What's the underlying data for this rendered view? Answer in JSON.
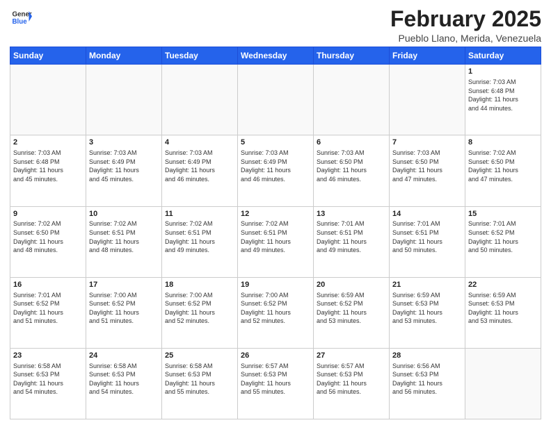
{
  "header": {
    "logo_general": "General",
    "logo_blue": "Blue",
    "month_title": "February 2025",
    "location": "Pueblo Llano, Merida, Venezuela"
  },
  "weekdays": [
    "Sunday",
    "Monday",
    "Tuesday",
    "Wednesday",
    "Thursday",
    "Friday",
    "Saturday"
  ],
  "weeks": [
    [
      {
        "day": "",
        "info": ""
      },
      {
        "day": "",
        "info": ""
      },
      {
        "day": "",
        "info": ""
      },
      {
        "day": "",
        "info": ""
      },
      {
        "day": "",
        "info": ""
      },
      {
        "day": "",
        "info": ""
      },
      {
        "day": "1",
        "info": "Sunrise: 7:03 AM\nSunset: 6:48 PM\nDaylight: 11 hours\nand 44 minutes."
      }
    ],
    [
      {
        "day": "2",
        "info": "Sunrise: 7:03 AM\nSunset: 6:48 PM\nDaylight: 11 hours\nand 45 minutes."
      },
      {
        "day": "3",
        "info": "Sunrise: 7:03 AM\nSunset: 6:49 PM\nDaylight: 11 hours\nand 45 minutes."
      },
      {
        "day": "4",
        "info": "Sunrise: 7:03 AM\nSunset: 6:49 PM\nDaylight: 11 hours\nand 46 minutes."
      },
      {
        "day": "5",
        "info": "Sunrise: 7:03 AM\nSunset: 6:49 PM\nDaylight: 11 hours\nand 46 minutes."
      },
      {
        "day": "6",
        "info": "Sunrise: 7:03 AM\nSunset: 6:50 PM\nDaylight: 11 hours\nand 46 minutes."
      },
      {
        "day": "7",
        "info": "Sunrise: 7:03 AM\nSunset: 6:50 PM\nDaylight: 11 hours\nand 47 minutes."
      },
      {
        "day": "8",
        "info": "Sunrise: 7:02 AM\nSunset: 6:50 PM\nDaylight: 11 hours\nand 47 minutes."
      }
    ],
    [
      {
        "day": "9",
        "info": "Sunrise: 7:02 AM\nSunset: 6:50 PM\nDaylight: 11 hours\nand 48 minutes."
      },
      {
        "day": "10",
        "info": "Sunrise: 7:02 AM\nSunset: 6:51 PM\nDaylight: 11 hours\nand 48 minutes."
      },
      {
        "day": "11",
        "info": "Sunrise: 7:02 AM\nSunset: 6:51 PM\nDaylight: 11 hours\nand 49 minutes."
      },
      {
        "day": "12",
        "info": "Sunrise: 7:02 AM\nSunset: 6:51 PM\nDaylight: 11 hours\nand 49 minutes."
      },
      {
        "day": "13",
        "info": "Sunrise: 7:01 AM\nSunset: 6:51 PM\nDaylight: 11 hours\nand 49 minutes."
      },
      {
        "day": "14",
        "info": "Sunrise: 7:01 AM\nSunset: 6:51 PM\nDaylight: 11 hours\nand 50 minutes."
      },
      {
        "day": "15",
        "info": "Sunrise: 7:01 AM\nSunset: 6:52 PM\nDaylight: 11 hours\nand 50 minutes."
      }
    ],
    [
      {
        "day": "16",
        "info": "Sunrise: 7:01 AM\nSunset: 6:52 PM\nDaylight: 11 hours\nand 51 minutes."
      },
      {
        "day": "17",
        "info": "Sunrise: 7:00 AM\nSunset: 6:52 PM\nDaylight: 11 hours\nand 51 minutes."
      },
      {
        "day": "18",
        "info": "Sunrise: 7:00 AM\nSunset: 6:52 PM\nDaylight: 11 hours\nand 52 minutes."
      },
      {
        "day": "19",
        "info": "Sunrise: 7:00 AM\nSunset: 6:52 PM\nDaylight: 11 hours\nand 52 minutes."
      },
      {
        "day": "20",
        "info": "Sunrise: 6:59 AM\nSunset: 6:52 PM\nDaylight: 11 hours\nand 53 minutes."
      },
      {
        "day": "21",
        "info": "Sunrise: 6:59 AM\nSunset: 6:53 PM\nDaylight: 11 hours\nand 53 minutes."
      },
      {
        "day": "22",
        "info": "Sunrise: 6:59 AM\nSunset: 6:53 PM\nDaylight: 11 hours\nand 53 minutes."
      }
    ],
    [
      {
        "day": "23",
        "info": "Sunrise: 6:58 AM\nSunset: 6:53 PM\nDaylight: 11 hours\nand 54 minutes."
      },
      {
        "day": "24",
        "info": "Sunrise: 6:58 AM\nSunset: 6:53 PM\nDaylight: 11 hours\nand 54 minutes."
      },
      {
        "day": "25",
        "info": "Sunrise: 6:58 AM\nSunset: 6:53 PM\nDaylight: 11 hours\nand 55 minutes."
      },
      {
        "day": "26",
        "info": "Sunrise: 6:57 AM\nSunset: 6:53 PM\nDaylight: 11 hours\nand 55 minutes."
      },
      {
        "day": "27",
        "info": "Sunrise: 6:57 AM\nSunset: 6:53 PM\nDaylight: 11 hours\nand 56 minutes."
      },
      {
        "day": "28",
        "info": "Sunrise: 6:56 AM\nSunset: 6:53 PM\nDaylight: 11 hours\nand 56 minutes."
      },
      {
        "day": "",
        "info": ""
      }
    ]
  ]
}
